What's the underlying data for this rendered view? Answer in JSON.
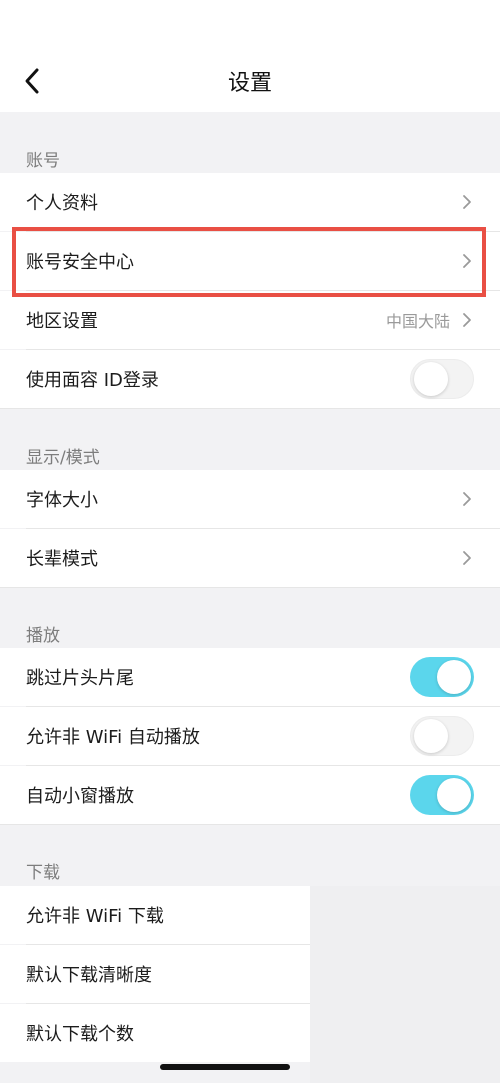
{
  "header": {
    "title": "设置"
  },
  "sections": {
    "account": {
      "title": "账号",
      "profile": "个人资料",
      "security": "账号安全中心",
      "region_label": "地区设置",
      "region_value": "中国大陆",
      "faceid": "使用面容 ID登录"
    },
    "display": {
      "title": "显示/模式",
      "font": "字体大小",
      "elder": "长辈模式"
    },
    "playback": {
      "title": "播放",
      "skip": "跳过片头片尾",
      "nonwifi": "允许非 WiFi 自动播放",
      "mini": "自动小窗播放"
    },
    "download": {
      "title": "下载",
      "nonwifi": "允许非 WiFi 下载",
      "quality": "默认下载清晰度",
      "count": "默认下载个数"
    }
  },
  "toggles": {
    "faceid": false,
    "skip": true,
    "nonwifi_play": false,
    "mini": true
  },
  "colors": {
    "accent_on": "#5bd6ec",
    "highlight": "#e94f44",
    "background": "#f2f2f4"
  },
  "icons": {
    "back": "chevron-left-icon",
    "row_arrow": "chevron-right-icon"
  }
}
